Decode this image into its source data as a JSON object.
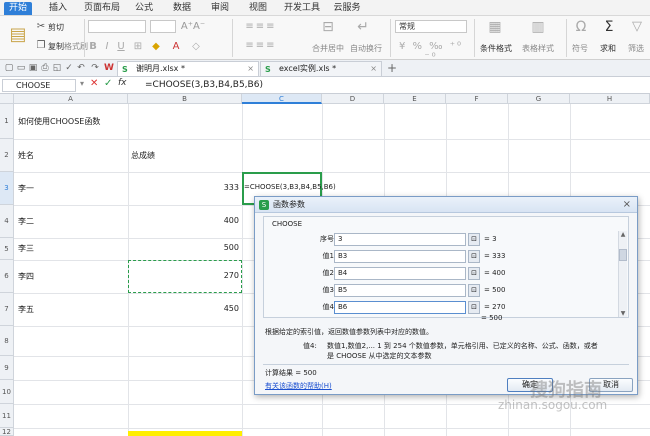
{
  "menu": {
    "tabs": [
      "开始",
      "插入",
      "页面布局",
      "公式",
      "数据",
      "审阅",
      "视图",
      "开发工具",
      "云服务"
    ]
  },
  "ribbon": {
    "cut": "剪切",
    "copy": "复制",
    "format_painter": "格式刷",
    "merge_center": "合并居中",
    "wrap": "自动换行",
    "number_format": "常规",
    "conditional_format": "条件格式",
    "table_style": "表格样式",
    "symbol": "符号",
    "sum": "求和",
    "filter": "筛选"
  },
  "doc_tabs": [
    {
      "name": "谢明月.xlsx *"
    },
    {
      "name": "excel实例.xls *"
    }
  ],
  "formula_bar": {
    "name_box": "CHOOSE",
    "formula": "=CHOOSE(3,B3,B4,B5,B6)"
  },
  "grid": {
    "columns": [
      "A",
      "B",
      "C",
      "D",
      "E",
      "F",
      "G",
      "H"
    ],
    "rows": [
      "1",
      "2",
      "3",
      "4",
      "5",
      "6",
      "7",
      "8",
      "9",
      "10",
      "11",
      "12"
    ],
    "a1": "如何使用CHOOSE函数",
    "a2": "姓名",
    "b2": "总成绩",
    "a3": "李一",
    "b3": "333",
    "c3": "=CHOOSE(3,B3,B4,B5,B6)",
    "a4": "李二",
    "b4": "400",
    "a5": "李三",
    "b5": "500",
    "a6": "李四",
    "b6": "270",
    "a7": "李五",
    "b7": "450"
  },
  "dialog": {
    "title": "函数参数",
    "func_name": "CHOOSE",
    "args": [
      {
        "label": "序号",
        "value": "3",
        "result": "= 3"
      },
      {
        "label": "值1",
        "value": "B3",
        "result": "= 333"
      },
      {
        "label": "值2",
        "value": "B4",
        "result": "= 400"
      },
      {
        "label": "值3",
        "value": "B5",
        "result": "= 500"
      },
      {
        "label": "值4",
        "value": "B6",
        "result": "= 270"
      }
    ],
    "total": "= 500",
    "description": "根据给定的索引值，返回数值参数列表中对应的数值。",
    "arg_help_label": "值4:",
    "arg_help_line1": "数值1,数值2,... 1 到 254 个数值参数，单元格引用、已定义的名称、公式、函数，或者",
    "arg_help_line2": "是 CHOOSE 从中选定的文本参数",
    "calc_result": "计算结果 = 500",
    "help_link": "有关该函数的帮助(H)",
    "ok": "确定",
    "cancel": "取消"
  },
  "watermark": "搜狗指南",
  "watermark_url": "zhinan.sogou.com"
}
